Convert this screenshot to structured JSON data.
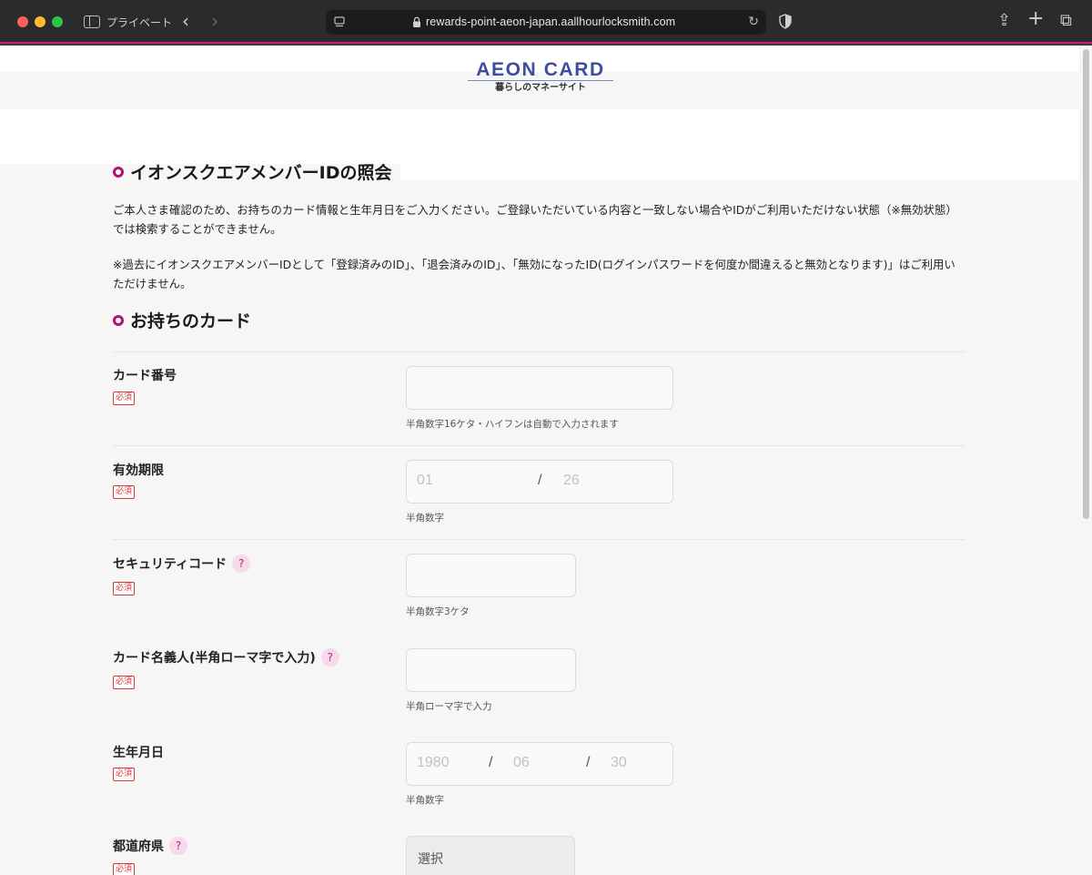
{
  "browser": {
    "private_label": "プライベート",
    "url": "rewards-point-aeon-japan.aallhourlocksmith.com",
    "back_glyph": "‹",
    "forward_glyph": "›",
    "reload_glyph": "↻",
    "share_glyph": "⇪",
    "new_tab_glyph": "+",
    "tabs_glyph": "⧉"
  },
  "logo": {
    "main": "AEON CARD",
    "tagline": "暮らしのマネーサイト"
  },
  "section1": {
    "title": "イオンスクエアメンバーIDの照会",
    "para1": "ご本人さま確認のため、お持ちのカード情報と生年月日をご入力ください。ご登録いただいている内容と一致しない場合やIDがご利用いただけない状態（※無効状態）では検索することができません。",
    "para2": "※過去にイオンスクエアメンバーIDとして「登録済みのID」、「退会済みのID」、「無効になったID(ログインパスワードを何度か間違えると無効となります)」はご利用いただけません。"
  },
  "section2": {
    "title": "お持ちのカード",
    "required_label": "必須",
    "help_glyph": "?",
    "fields": {
      "card_number": {
        "label": "カード番号",
        "hint": "半角数字16ケタ・ハイフンは自動で入力されます"
      },
      "expiry": {
        "label": "有効期限",
        "month_placeholder": "01",
        "year_placeholder": "26",
        "separator": "/",
        "hint": "半角数字"
      },
      "security_code": {
        "label": "セキュリティコード",
        "hint": "半角数字3ケタ"
      },
      "cardholder": {
        "label": "カード名義人(半角ローマ字で入力)",
        "hint": "半角ローマ字で入力"
      },
      "birthdate": {
        "label": "生年月日",
        "year_placeholder": "1980",
        "month_placeholder": "06",
        "day_placeholder": "30",
        "separator": "/",
        "hint": "半角数字"
      },
      "prefecture": {
        "label": "都道府県",
        "selected": "選択"
      }
    }
  },
  "colors": {
    "accent": "#c0206f",
    "brand_blue": "#3d4da0",
    "required_red": "#d23a3a"
  }
}
